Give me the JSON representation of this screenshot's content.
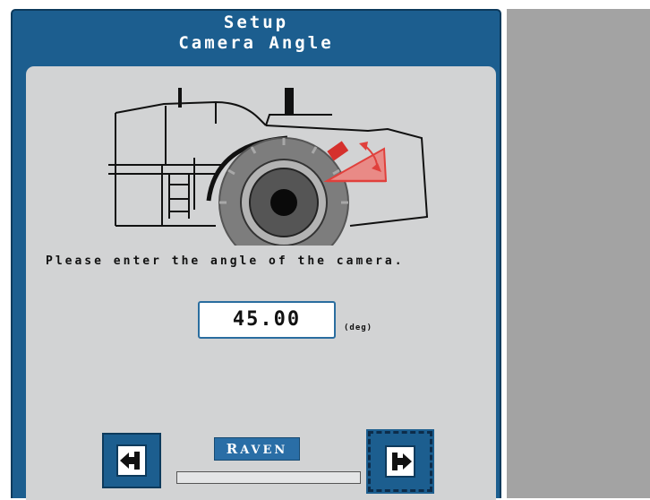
{
  "dialog": {
    "title_line1": "Setup",
    "title_line2": "Camera Angle",
    "prompt": "Please enter the angle of the camera.",
    "angle_value": "45.00",
    "unit": "(deg)",
    "logo_first": "R",
    "logo_rest": "AVEN",
    "progress": 0.0
  },
  "nav": {
    "back_icon": "arrow-left-icon",
    "next_icon": "arrow-right-icon"
  },
  "colors": {
    "frame": "#1c5e8f",
    "panel": "#d2d3d4",
    "accent_red": "#e0403c",
    "background_right": "#a3a3a3"
  }
}
